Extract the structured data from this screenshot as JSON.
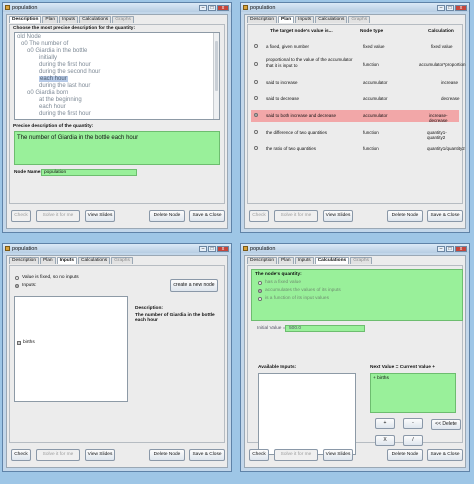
{
  "common": {
    "window_title": "population",
    "tabs": [
      "Description",
      "Plan",
      "Inputs",
      "Calculations",
      "Graphs"
    ],
    "buttons": {
      "check": "Check",
      "solve": "Solve it for me",
      "view_slides": "View Slides",
      "delete_node": "Delete Node",
      "save_close": "Save & Close"
    },
    "window_controls": {
      "min": "–",
      "max": "□",
      "close": "x"
    }
  },
  "w1": {
    "prompt": "Choose the most precise description for the quantity:",
    "tree": [
      "old Node",
      "o0 The number of",
      "o0 Giardia in the bottle",
      "initially",
      "during the first hour",
      "during the second hour",
      "each hour",
      "during the last hour",
      "o0 Giardia born",
      "at the beginning",
      "each hour",
      "during the first hour"
    ],
    "precise_label": "Precise description of the quantity:",
    "precise_value": "The number of Giardia in the bottle each hour",
    "node_name_label": "Node Name:",
    "node_name_value": "population"
  },
  "w2": {
    "headers": {
      "target": "The target node's value is...",
      "type": "Node type",
      "calc": "Calculation"
    },
    "rows": [
      {
        "desc": "a fixed, given number",
        "type": "fixed value",
        "calc": "fixed value",
        "selected": false
      },
      {
        "desc": "proportional to the value of the accumulator that it is input to",
        "type": "function",
        "calc": "accumulator*proportion",
        "selected": false
      },
      {
        "desc": "said to increase",
        "type": "accumulator",
        "calc": "increase",
        "selected": false
      },
      {
        "desc": "said to decrease",
        "type": "accumulator",
        "calc": "decrease",
        "selected": false
      },
      {
        "desc": "said to both increase and decrease",
        "type": "accumulator",
        "calc": "increase-decrease",
        "selected": true
      },
      {
        "desc": "the difference of two quantities",
        "type": "function",
        "calc": "quantity1-quantity2",
        "selected": false
      },
      {
        "desc": "the ratio of two quantities",
        "type": "function",
        "calc": "quantity1/quantity2",
        "selected": false
      }
    ]
  },
  "w3": {
    "radio_fixed": "Value is fixed, so no inputs",
    "radio_inputs": "Inputs:",
    "create_node": "create a new node",
    "input_item": "births",
    "desc_label": "Description:",
    "desc_value": "The number of Giardia in the bottle each hour"
  },
  "w4": {
    "quantity_label": "The node's quantity:",
    "options": [
      "has a fixed value",
      "accumulates the values of its inputs",
      "is a function of its input values"
    ],
    "initial_label": "Initial Value =",
    "initial_value": "500.0",
    "available_label": "Available Inputs:",
    "next_label": "Next Value = Current Value +",
    "next_value": "+ births",
    "ops": [
      "+",
      "-",
      "X",
      "/"
    ],
    "delete": "<< Delete"
  }
}
